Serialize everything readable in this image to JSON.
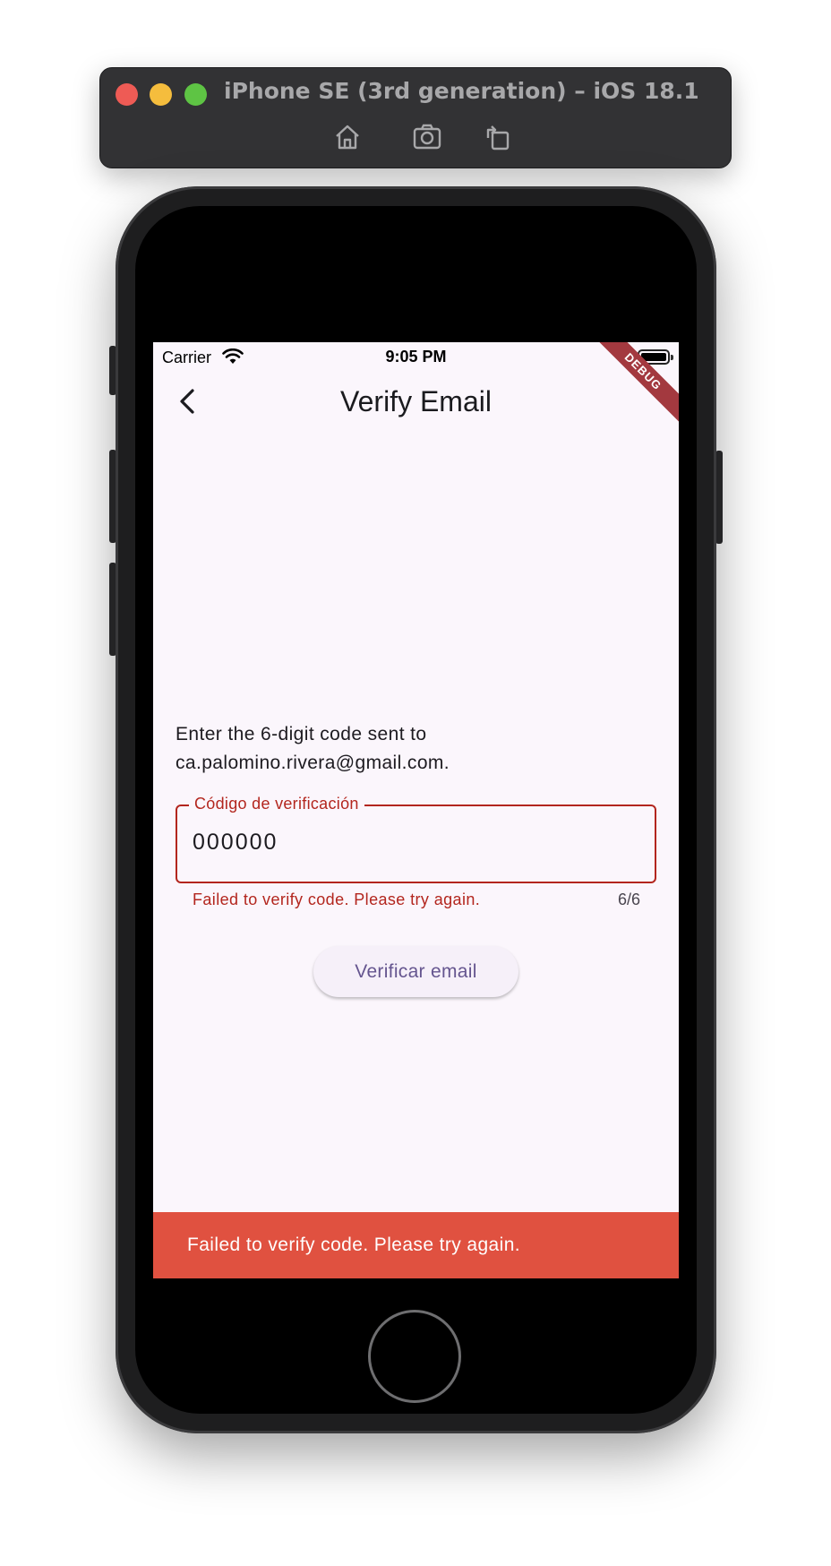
{
  "simulator": {
    "title": "iPhone SE (3rd generation) – iOS 18.1",
    "tools": [
      "home-icon",
      "screenshot-icon",
      "rotate-icon"
    ]
  },
  "status_bar": {
    "carrier": "Carrier",
    "time": "9:05 PM"
  },
  "debug_banner": "DEBUG",
  "app_bar": {
    "title": "Verify Email",
    "back_icon": "chevron-left-icon"
  },
  "instructions": "Enter the 6-digit code sent to ca.palomino.rivera@gmail.com.",
  "code_field": {
    "label": "Código de verificación",
    "value": "000000",
    "error": "Failed to verify code. Please try again.",
    "counter": "6/6"
  },
  "verify_button": "Verificar email",
  "snackbar": "Failed to verify code. Please try again.",
  "colors": {
    "error": "#b3261e",
    "snackbar": "#e05140",
    "button_text": "#65558f",
    "screen_bg": "#fbf6fc"
  }
}
